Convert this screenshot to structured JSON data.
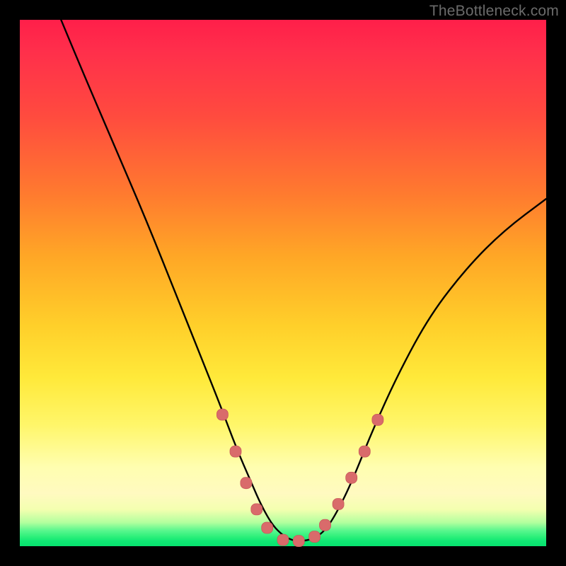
{
  "watermark": "TheBottleneck.com",
  "colors": {
    "page_bg": "#000000",
    "curve_stroke": "#000000",
    "marker_fill": "#d96b6b",
    "marker_stroke": "#c85a5a",
    "gradient_top": "#ff1f4a",
    "gradient_mid": "#ffe93a",
    "gradient_bottom": "#07e36f"
  },
  "chart_data": {
    "type": "line",
    "title": "",
    "xlabel": "",
    "ylabel": "",
    "xlim": [
      0,
      100
    ],
    "ylim": [
      0,
      100
    ],
    "grid": false,
    "series": [
      {
        "name": "curve",
        "x_norm": [
          7,
          12,
          18,
          24,
          30,
          34,
          38,
          41,
          44,
          46,
          48,
          50,
          52,
          54,
          56,
          58,
          60,
          63,
          67,
          72,
          78,
          85,
          92,
          100
        ],
        "y_norm": [
          102,
          90,
          76,
          62,
          47,
          37,
          27,
          19,
          12,
          7.5,
          4,
          2,
          1,
          1,
          1.5,
          3,
          6,
          12,
          22,
          33,
          44,
          53,
          60,
          66
        ],
        "comment": "x_norm and y_norm are percentages of the plot-area width/height; y is measured from the bottom (0 = bottom green band, 100 = top). Curve is an asymmetric V: steep left limb starting off-top, flat trough ~x=50-56 near the bottom, shallower right limb rising to ~66%."
      }
    ],
    "markers": {
      "name": "highlighted-points",
      "color": "#d96b6b",
      "x_norm": [
        38.5,
        41,
        43,
        45,
        47,
        50,
        53,
        56,
        58,
        60.5,
        63,
        65.5,
        68
      ],
      "y_norm": [
        25,
        18,
        12,
        7,
        3.5,
        1.2,
        1,
        1.8,
        4,
        8,
        13,
        18,
        24
      ],
      "comment": "Rounded salmon dots clustered along the lower portion of both limbs of the V, denser near the trough."
    }
  }
}
